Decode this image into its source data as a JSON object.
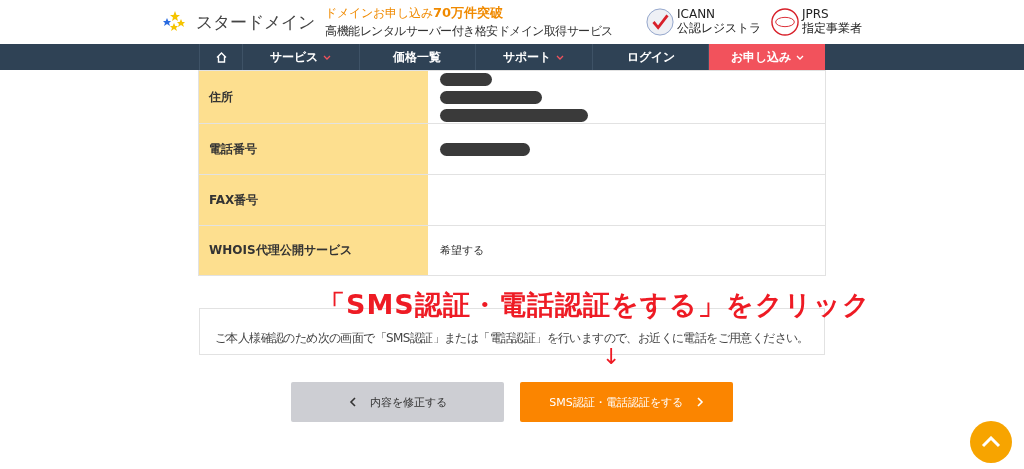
{
  "header": {
    "logo_text": "スタードメイン",
    "tagline_prefix": "ドメインお申し込み",
    "tagline_count": "70万件突破",
    "tagline_sub": "高機能レンタルサーバー付き格安ドメイン取得サービス",
    "badges": [
      {
        "kind": "icann",
        "line1": "ICANN",
        "line2": "公認レジストラ"
      },
      {
        "kind": "jprs",
        "line1": "JPRS",
        "line2": "指定事業者"
      }
    ]
  },
  "nav": [
    {
      "kind": "home",
      "selected": false,
      "dropdown": false
    },
    {
      "kind": "text",
      "label": "サービス",
      "selected": false,
      "dropdown": true
    },
    {
      "kind": "text",
      "label": "価格一覧",
      "selected": false,
      "dropdown": false
    },
    {
      "kind": "text",
      "label": "サポート",
      "selected": false,
      "dropdown": true
    },
    {
      "kind": "text",
      "label": "ログイン",
      "selected": false,
      "dropdown": false
    },
    {
      "kind": "text",
      "label": "お申し込み",
      "selected": true,
      "dropdown": true
    }
  ],
  "table": {
    "rows": [
      {
        "label": "住所",
        "kind": "redacted"
      },
      {
        "label": "電話番号",
        "kind": "redacted"
      },
      {
        "label": "FAX番号",
        "kind": "empty"
      },
      {
        "label": "WHOIS代理公開サービス",
        "kind": "text",
        "value": "希望する"
      }
    ]
  },
  "notice": "ご本人様確認のため次の画面で「SMS認証」または「電話認証」を行いますので、お近くに電話をご用意ください。",
  "buttons": [
    {
      "kind": "back",
      "label": "内容を修正する"
    },
    {
      "kind": "next",
      "label": "SMS認証・電話認証をする"
    }
  ],
  "annotation": {
    "text": "「SMS認証・電話認証をする」をクリック",
    "arrow": "↓"
  }
}
